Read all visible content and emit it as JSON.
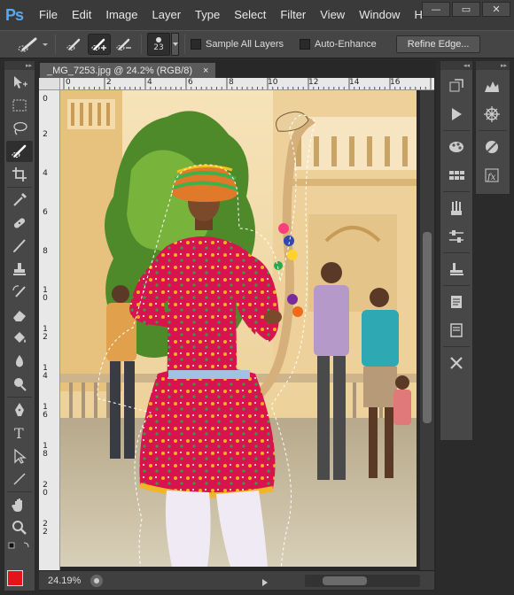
{
  "app": {
    "logo": "Ps"
  },
  "menu": [
    "File",
    "Edit",
    "Image",
    "Layer",
    "Type",
    "Select",
    "Filter",
    "View",
    "Window",
    "H"
  ],
  "window_controls": [
    {
      "name": "minimize",
      "glyph": "—"
    },
    {
      "name": "maximize",
      "glyph": "▭"
    },
    {
      "name": "close",
      "glyph": "✕"
    }
  ],
  "options_bar": {
    "brush_size": "23",
    "sample_all_layers": {
      "label": "Sample All Layers",
      "checked": false
    },
    "auto_enhance": {
      "label": "Auto-Enhance",
      "checked": false
    },
    "refine_edge_label": "Refine Edge..."
  },
  "document": {
    "tab_title": "_MG_7253.jpg @ 24.2% (RGB/8)",
    "close_glyph": "×",
    "zoom": "24.19%",
    "ruler_top": [
      "0",
      "2",
      "4",
      "6",
      "8",
      "10",
      "12",
      "14",
      "16"
    ],
    "ruler_left": [
      "0",
      "2",
      "4",
      "6",
      "8",
      "10",
      "12",
      "14",
      "16",
      "18",
      "20",
      "22"
    ]
  },
  "tools": [
    "move-tool",
    "marquee-tool",
    "lasso-tool",
    "quick-selection-tool",
    "crop-tool",
    "eyedropper-tool",
    "spot-healing-tool",
    "brush-tool",
    "clone-stamp-tool",
    "history-brush-tool",
    "eraser-tool",
    "paint-bucket-tool",
    "blur-tool",
    "dodge-tool",
    "pen-tool",
    "type-tool",
    "path-selection-tool",
    "line-tool",
    "hand-tool",
    "zoom-tool"
  ],
  "panels_col1": [
    "history-panel-icon",
    "actions-panel-icon",
    "color-panel-icon",
    "swatches-panel-icon",
    "brush-presets-panel-icon",
    "adjustments-panel-icon",
    "clone-source-panel-icon",
    "notes-panel-icon",
    "paragraph-panel-icon",
    "tool-presets-panel-icon"
  ],
  "panels_col2": [
    "histogram-panel-icon",
    "navigator-panel-icon",
    "masks-panel-icon",
    "styles-panel-icon"
  ],
  "colors": {
    "foreground": "#e3151a",
    "background": "#222222",
    "accent": "#5aa7f0"
  }
}
